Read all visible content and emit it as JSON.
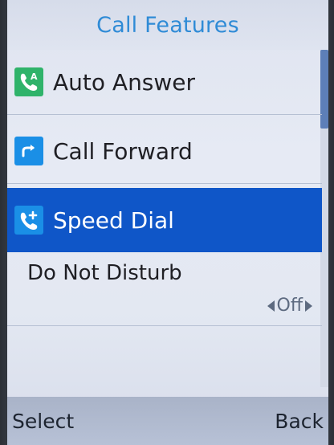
{
  "title": "Call Features",
  "menu": {
    "items": [
      {
        "label": "Auto Answer",
        "icon": "auto-answer-icon"
      },
      {
        "label": "Call Forward",
        "icon": "call-forward-icon"
      },
      {
        "label": "Speed Dial",
        "icon": "speed-dial-icon",
        "selected": true
      }
    ],
    "dnd": {
      "label": "Do Not Disturb",
      "value": "Off"
    }
  },
  "softkeys": {
    "left": "Select",
    "right": "Back"
  },
  "colors": {
    "title": "#2f8bd6",
    "selection": "#0f56c8",
    "icon_green": "#2fb36a",
    "icon_blue": "#1a8fe6"
  }
}
